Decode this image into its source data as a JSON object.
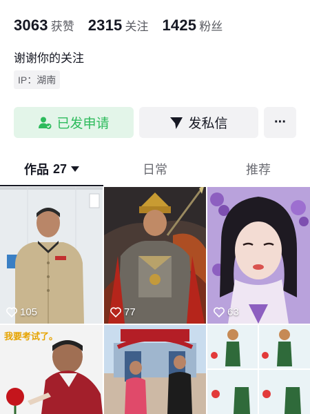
{
  "stats": {
    "likes": {
      "num": "3063",
      "label": "获赞"
    },
    "following": {
      "num": "2315",
      "label": "关注"
    },
    "fans": {
      "num": "1425",
      "label": "粉丝"
    }
  },
  "bio": "谢谢你的关注",
  "ip_tag": "IP：湖南",
  "actions": {
    "apply_label": "已发申请",
    "message_label": "发私信",
    "more_label": "···"
  },
  "tabs": {
    "works": {
      "label": "作品",
      "count": "27"
    },
    "daily": {
      "label": "日常"
    },
    "recommend": {
      "label": "推荐"
    }
  },
  "grid": [
    {
      "likes": "105"
    },
    {
      "likes": "77"
    },
    {
      "likes": "63"
    },
    {
      "overlay": "我要考试了。"
    },
    {},
    {}
  ],
  "colors": {
    "accent_green": "#2dbb5c",
    "text_primary": "#161823",
    "text_secondary": "#5b5c63"
  }
}
